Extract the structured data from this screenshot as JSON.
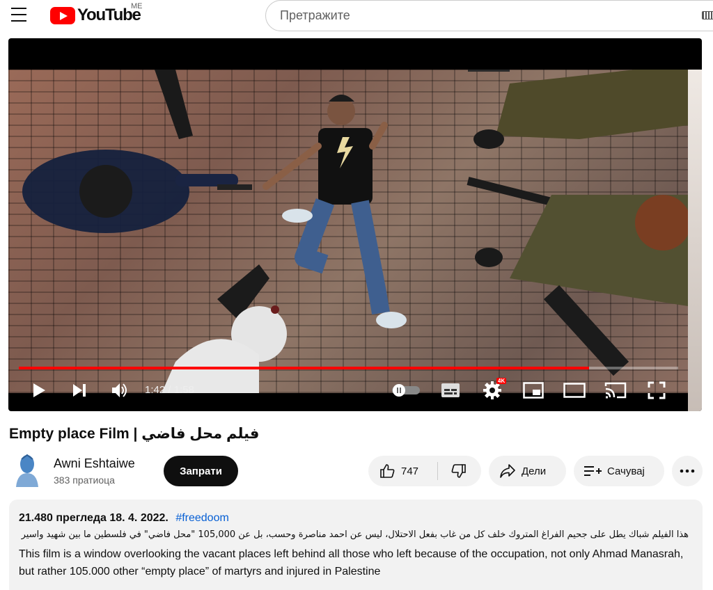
{
  "header": {
    "logo_text": "YouTube",
    "region": "ME",
    "search_placeholder": "Претражите"
  },
  "player": {
    "time_current": "1:42",
    "time_total": "1:58",
    "time_display": "1:42 / 1:58",
    "progress_fraction": 0.865,
    "quality_badge": "4K",
    "progress_color": "#ff0000"
  },
  "video": {
    "title": "Empty place Film | فيلم محل فاضي"
  },
  "channel": {
    "name": "Awni Eshtaiwe",
    "subscribers": "383 пратиоца",
    "subscribe_label": "Запрати"
  },
  "actions": {
    "likes": "747",
    "share_label": "Дели",
    "save_label": "Сачувај"
  },
  "description": {
    "views_date": "21.480 прегледа  18. 4. 2022.",
    "hashtag": "#freedoom",
    "arabic_text": "هذا الفيلم شباك يطل على جحيم الفراغ المتروك خلف كل من غاب بفعل الاحتلال، ليس عن احمد مناصرة وحسب، بل عن 105,000 \"محل فاضي\" في فلسطين ما بين شهيد واسير",
    "english_text": "This film is a window overlooking the vacant places left behind all those who left because of the occupation, not only Ahmad Manasrah, but rather 105.000 other “empty place” of martyrs and injured in Palestine"
  }
}
